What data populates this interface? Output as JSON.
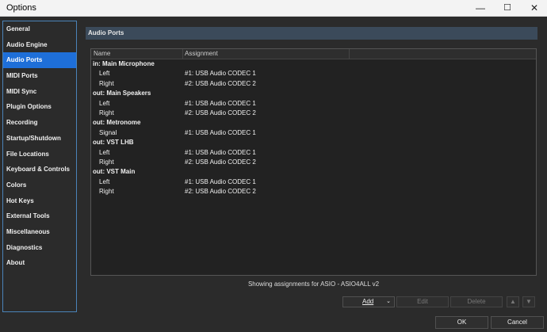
{
  "window": {
    "title": "Options",
    "minimize": "—",
    "maximize": "☐",
    "close": "✕"
  },
  "sidebar": {
    "items": [
      {
        "label": "General"
      },
      {
        "label": "Audio Engine"
      },
      {
        "label": "Audio Ports",
        "selected": true
      },
      {
        "label": "MIDI Ports"
      },
      {
        "label": "MIDI Sync"
      },
      {
        "label": "Plugin Options"
      },
      {
        "label": "Recording"
      },
      {
        "label": "Startup/Shutdown"
      },
      {
        "label": "File Locations"
      },
      {
        "label": "Keyboard & Controls"
      },
      {
        "label": "Colors"
      },
      {
        "label": "Hot Keys"
      },
      {
        "label": "External Tools"
      },
      {
        "label": "Miscellaneous"
      },
      {
        "label": "Diagnostics"
      },
      {
        "label": "About"
      }
    ]
  },
  "panel": {
    "title": "Audio Ports"
  },
  "table": {
    "headers": {
      "name": "Name",
      "assignment": "Assignment"
    },
    "rows": [
      {
        "type": "group",
        "name": "in: Main Microphone",
        "assignment": ""
      },
      {
        "type": "port",
        "name": "Left",
        "assignment": "#1: USB Audio CODEC  1"
      },
      {
        "type": "port",
        "name": "Right",
        "assignment": "#2: USB Audio CODEC  2"
      },
      {
        "type": "group",
        "name": "out: Main Speakers",
        "assignment": ""
      },
      {
        "type": "port",
        "name": "Left",
        "assignment": "#1: USB Audio CODEC  1"
      },
      {
        "type": "port",
        "name": "Right",
        "assignment": "#2: USB Audio CODEC  2"
      },
      {
        "type": "group",
        "name": "out: Metronome",
        "assignment": ""
      },
      {
        "type": "port",
        "name": "Signal",
        "assignment": "#1: USB Audio CODEC  1"
      },
      {
        "type": "group",
        "name": "out: VST LHB",
        "assignment": ""
      },
      {
        "type": "port",
        "name": "Left",
        "assignment": "#1: USB Audio CODEC  1"
      },
      {
        "type": "port",
        "name": "Right",
        "assignment": "#2: USB Audio CODEC  2"
      },
      {
        "type": "group",
        "name": "out: VST Main",
        "assignment": ""
      },
      {
        "type": "port",
        "name": "Left",
        "assignment": "#1: USB Audio CODEC  1"
      },
      {
        "type": "port",
        "name": "Right",
        "assignment": "#2: USB Audio CODEC  2"
      }
    ]
  },
  "status": "Showing assignments for ASIO - ASIO4ALL v2",
  "buttons": {
    "add": "Add",
    "add_caret": "⌄",
    "edit": "Edit",
    "delete": "Delete",
    "up": "▲",
    "down": "▼",
    "ok": "OK",
    "cancel": "Cancel"
  }
}
